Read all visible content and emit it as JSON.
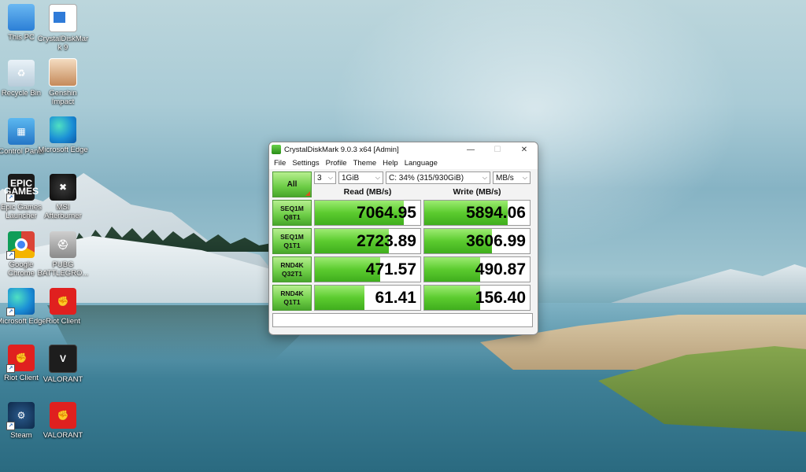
{
  "desktop": {
    "icons": [
      {
        "label": "This PC"
      },
      {
        "label": "CrystalDiskMark 9"
      },
      {
        "label": "Recycle Bin"
      },
      {
        "label": "Genshin Impact"
      },
      {
        "label": "Control Panel"
      },
      {
        "label": "Microsoft Edge"
      },
      {
        "label": "Epic Games Launcher"
      },
      {
        "label": "MSI Afterburner"
      },
      {
        "label": "Google Chrome"
      },
      {
        "label": "PUBG BATTLEGRO..."
      },
      {
        "label": "Microsoft Edge"
      },
      {
        "label": "Riot Client"
      },
      {
        "label": "Riot Client"
      },
      {
        "label": "VALORANT"
      },
      {
        "label": "Steam"
      },
      {
        "label": "VALORANT"
      }
    ]
  },
  "window": {
    "title": "CrystalDiskMark 9.0.3 x64 [Admin]",
    "controls": {
      "minimize": "—",
      "maximize": "☐",
      "close": "✕"
    },
    "menu": [
      "File",
      "Settings",
      "Profile",
      "Theme",
      "Help",
      "Language"
    ],
    "all_label": "All",
    "selects": {
      "count": "3",
      "size": "1GiB",
      "drive": "C: 34% (315/930GiB)",
      "unit": "MB/s"
    },
    "headers": {
      "read": "Read (MB/s)",
      "write": "Write (MB/s)"
    },
    "tests": [
      {
        "line1": "SEQ1M",
        "line2": "Q8T1",
        "read": "7064.95",
        "write": "5894.06",
        "read_fill": 0.84,
        "write_fill": 0.79
      },
      {
        "line1": "SEQ1M",
        "line2": "Q1T1",
        "read": "2723.89",
        "write": "3606.99",
        "read_fill": 0.7,
        "write_fill": 0.64
      },
      {
        "line1": "RND4K",
        "line2": "Q32T1",
        "read": "471.57",
        "write": "490.87",
        "read_fill": 0.62,
        "write_fill": 0.53
      },
      {
        "line1": "RND4K",
        "line2": "Q1T1",
        "read": "61.41",
        "write": "156.40",
        "read_fill": 0.47,
        "write_fill": 0.53
      }
    ],
    "comment": ""
  }
}
